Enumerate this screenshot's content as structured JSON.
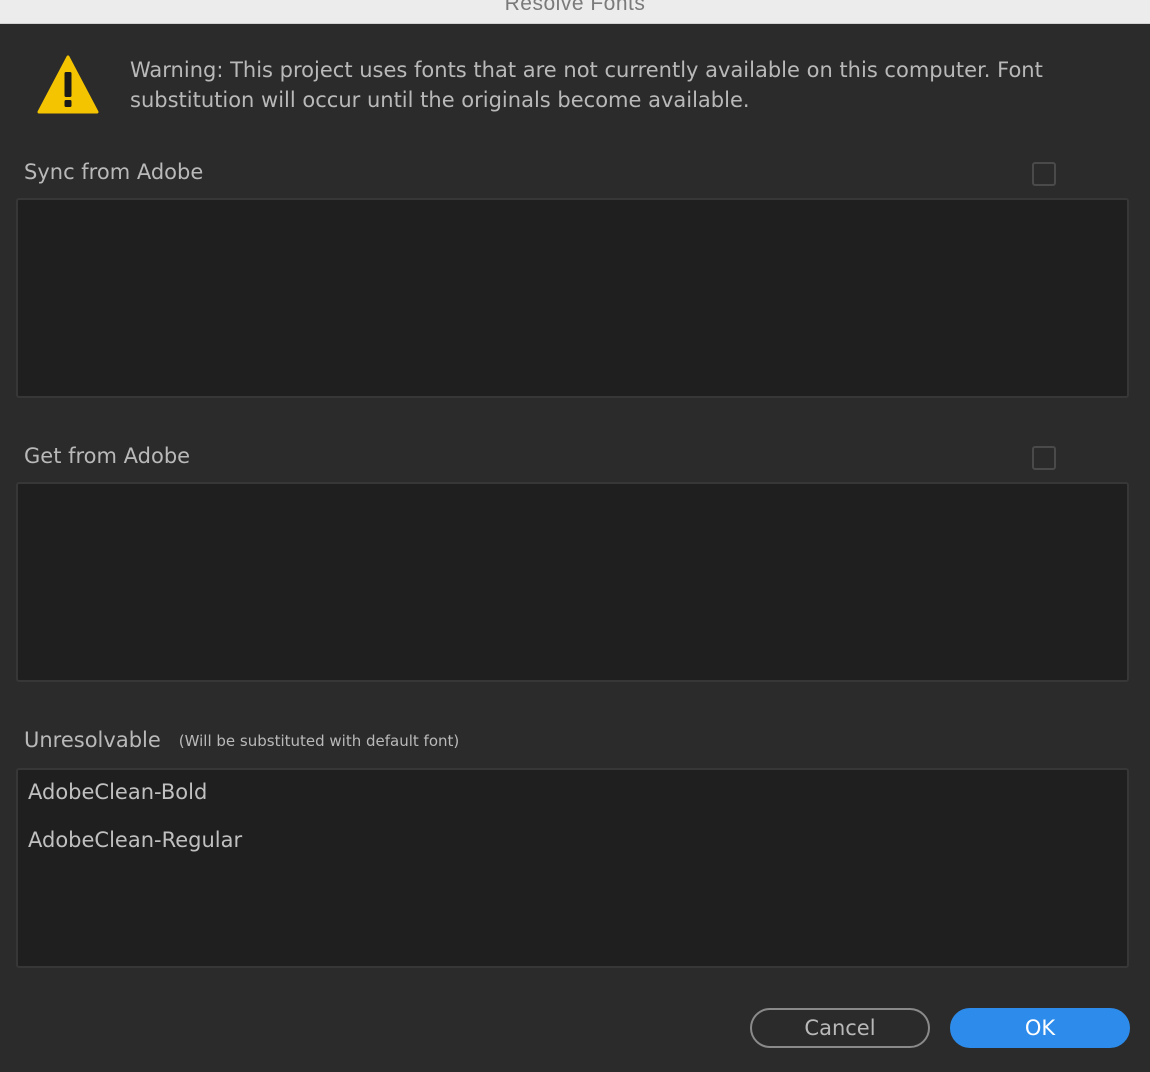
{
  "window": {
    "title": "Resolve Fonts"
  },
  "warning": {
    "icon": "warning-triangle-icon",
    "text": "Warning: This project uses fonts that are not currently available on this computer. Font substitution will occur until the originals become available."
  },
  "sections": {
    "sync": {
      "label": "Sync from Adobe",
      "checked": false,
      "items": []
    },
    "get": {
      "label": "Get from Adobe",
      "checked": false,
      "items": []
    },
    "unresolvable": {
      "label": "Unresolvable",
      "sublabel": "(Will be substituted with default font)",
      "items": [
        "AdobeClean-Bold",
        "AdobeClean-Regular"
      ]
    }
  },
  "buttons": {
    "cancel": "Cancel",
    "ok": "OK"
  },
  "colors": {
    "background": "#2b2b2b",
    "list_background": "#1f1f1f",
    "accent": "#2d8ceb",
    "warning": "#f5c400"
  }
}
